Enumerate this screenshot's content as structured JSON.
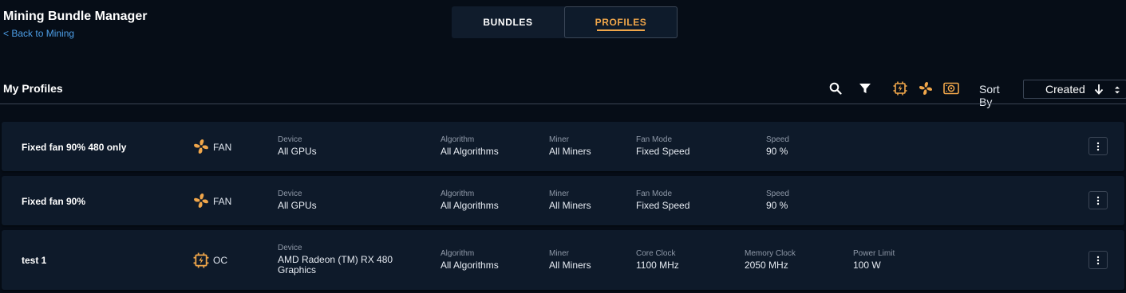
{
  "header": {
    "title": "Mining Bundle Manager",
    "back_link": "< Back to Mining"
  },
  "tabs": [
    {
      "label": "BUNDLES",
      "active": false
    },
    {
      "label": "PROFILES",
      "active": true
    }
  ],
  "section": {
    "title": "My Profiles",
    "sort_label": "Sort By",
    "sort_value": "Created"
  },
  "toolbar_icons": [
    "search-icon",
    "filter-icon",
    "oc-chip-icon",
    "fan-icon",
    "gpu-card-icon"
  ],
  "colors": {
    "accent": "#f0a64a",
    "link": "#4d9fe8",
    "background": "#060d17",
    "card": "#0e1a2a"
  },
  "profiles": [
    {
      "name": "Fixed fan 90% 480 only",
      "type_icon": "fan-icon",
      "type": "FAN",
      "fields": [
        {
          "label": "Device",
          "value": "All GPUs"
        },
        {
          "label": "Algorithm",
          "value": "All Algorithms"
        },
        {
          "label": "Miner",
          "value": "All Miners"
        },
        {
          "label": "Fan Mode",
          "value": "Fixed Speed"
        },
        {
          "label": "Speed",
          "value": "90 %"
        }
      ]
    },
    {
      "name": "Fixed fan 90%",
      "type_icon": "fan-icon",
      "type": "FAN",
      "fields": [
        {
          "label": "Device",
          "value": "All GPUs"
        },
        {
          "label": "Algorithm",
          "value": "All Algorithms"
        },
        {
          "label": "Miner",
          "value": "All Miners"
        },
        {
          "label": "Fan Mode",
          "value": "Fixed Speed"
        },
        {
          "label": "Speed",
          "value": "90 %"
        }
      ]
    },
    {
      "name": "test 1",
      "type_icon": "oc-chip-icon",
      "type": "OC",
      "fields": [
        {
          "label": "Device",
          "value": "AMD Radeon (TM) RX 480 Graphics"
        },
        {
          "label": "Algorithm",
          "value": "All Algorithms"
        },
        {
          "label": "Miner",
          "value": "All Miners"
        },
        {
          "label": "Core Clock",
          "value": "1100 MHz"
        },
        {
          "label": "Memory Clock",
          "value": "2050 MHz"
        },
        {
          "label": "Power Limit",
          "value": "100 W"
        }
      ]
    }
  ]
}
